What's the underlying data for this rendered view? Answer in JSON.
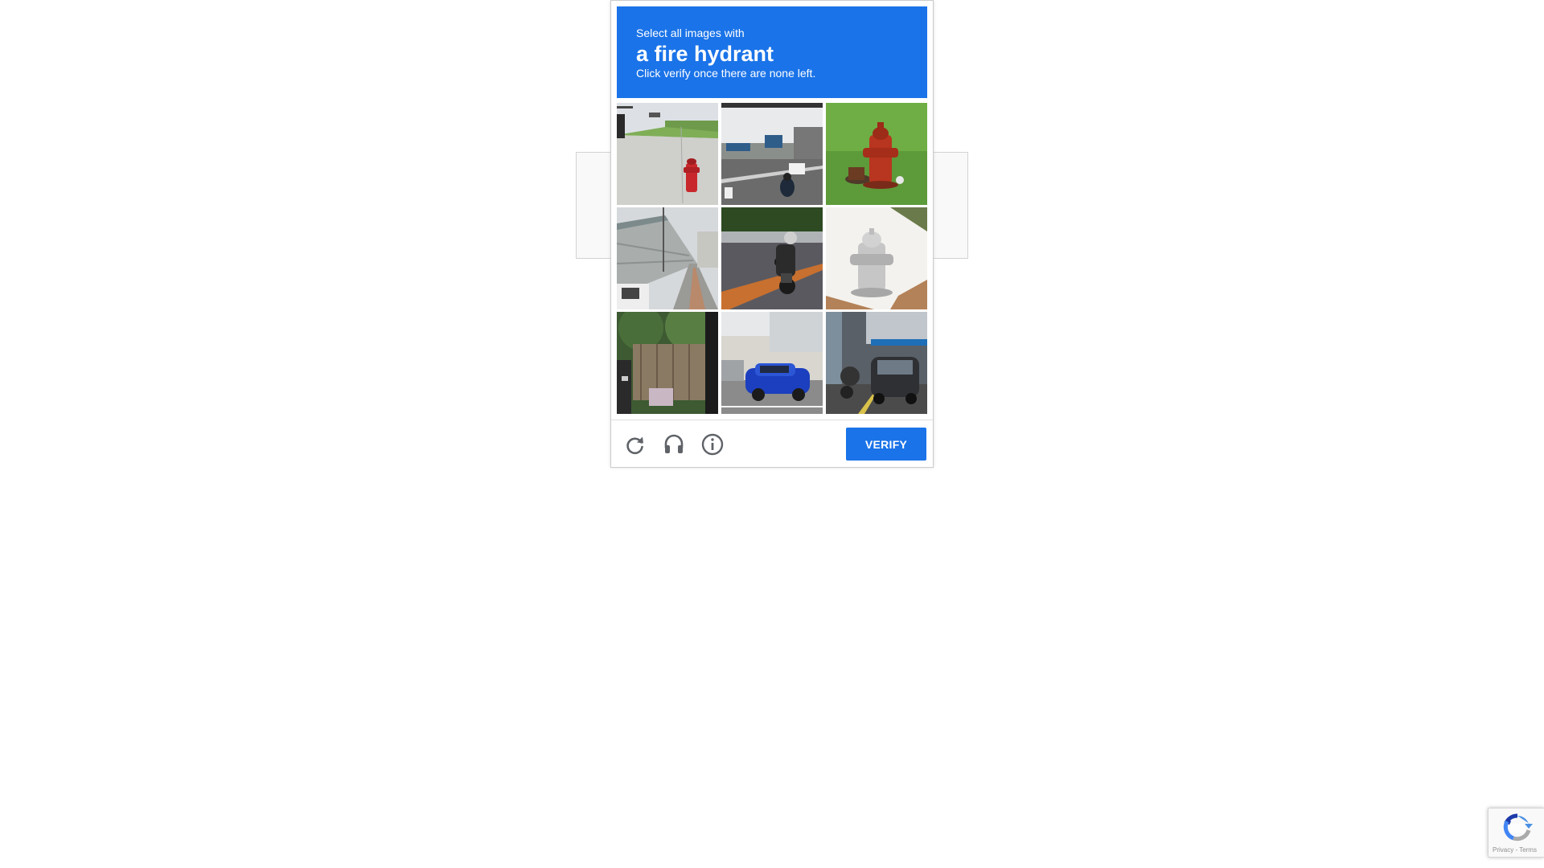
{
  "challenge": {
    "instruction_prefix": "Select all images with",
    "target_object": "a fire hydrant",
    "instruction_suffix": "Click verify once there are none left.",
    "tiles": [
      {
        "description": "fire hydrant on pavement near grass"
      },
      {
        "description": "motorcycle on highway"
      },
      {
        "description": "red fire hydrant in grass"
      },
      {
        "description": "bike path with noise barrier wall"
      },
      {
        "description": "motorcyclist on road"
      },
      {
        "description": "silver fire hydrant"
      },
      {
        "description": "trees and fence"
      },
      {
        "description": "blue car parked by building"
      },
      {
        "description": "cars and scooters on street"
      }
    ],
    "verify_label": "VERIFY",
    "accent_color": "#1a73e8"
  },
  "footer": {
    "reload_icon": "reload-icon",
    "audio_icon": "headphones-icon",
    "info_icon": "info-icon"
  },
  "badge": {
    "terms_text": "Privacy - Terms"
  }
}
